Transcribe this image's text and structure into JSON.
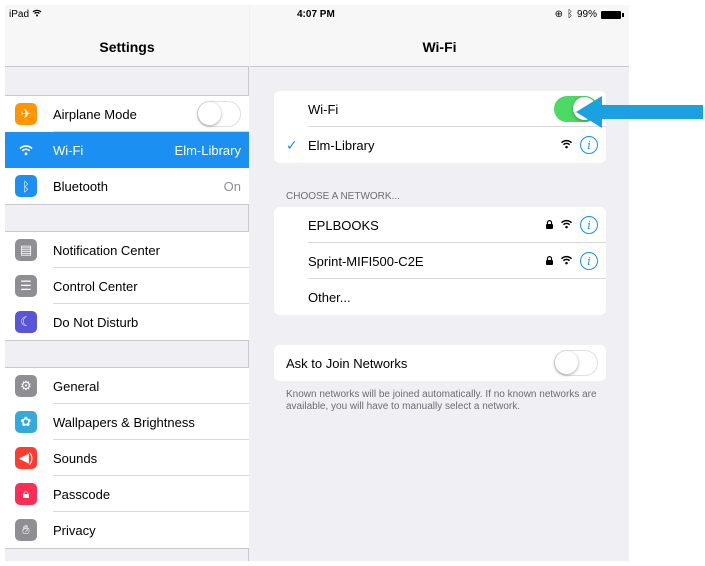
{
  "status_bar": {
    "device": "iPad",
    "time": "4:07 PM",
    "battery": "99%"
  },
  "left_pane": {
    "title": "Settings",
    "groups": [
      {
        "items": [
          {
            "label": "Airplane Mode",
            "icon": "airplane-icon",
            "icon_color": "#ff9500",
            "toggle": false
          },
          {
            "label": "Wi-Fi",
            "value": "Elm-Library",
            "icon": "wifi-icon",
            "icon_color": "#1b8ff2",
            "selected": true
          },
          {
            "label": "Bluetooth",
            "value": "On",
            "icon": "bluetooth-icon",
            "icon_color": "#1b8ff2"
          }
        ]
      },
      {
        "items": [
          {
            "label": "Notification Center",
            "icon": "notification-center-icon",
            "icon_color": "#8e8e93"
          },
          {
            "label": "Control Center",
            "icon": "control-center-icon",
            "icon_color": "#8e8e93"
          },
          {
            "label": "Do Not Disturb",
            "icon": "moon-icon",
            "icon_color": "#5856d6"
          }
        ]
      },
      {
        "items": [
          {
            "label": "General",
            "icon": "gear-icon",
            "icon_color": "#8e8e93"
          },
          {
            "label": "Wallpapers & Brightness",
            "icon": "flower-icon",
            "icon_color": "#34aadc"
          },
          {
            "label": "Sounds",
            "icon": "speaker-icon",
            "icon_color": "#ff3b30"
          },
          {
            "label": "Passcode",
            "icon": "lock-icon",
            "icon_color": "#ff2d55"
          },
          {
            "label": "Privacy",
            "icon": "hand-icon",
            "icon_color": "#8e8e93"
          }
        ]
      }
    ]
  },
  "right_pane": {
    "title": "Wi-Fi",
    "wifi_toggle_label": "Wi-Fi",
    "wifi_on": true,
    "connected_network": "Elm-Library",
    "choose_header": "CHOOSE A NETWORK...",
    "networks": [
      {
        "name": "EPLBOOKS",
        "locked": true
      },
      {
        "name": "Sprint-MIFI500-C2E",
        "locked": true
      }
    ],
    "other_label": "Other...",
    "ask_to_join_label": "Ask to Join Networks",
    "ask_to_join_on": false,
    "footnote": "Known networks will be joined automatically. If no known networks are available, you will have to manually select a network."
  },
  "colors": {
    "accent": "#1b8ff2",
    "toggle_on": "#4cd964",
    "arrow": "#1ba1e2"
  }
}
